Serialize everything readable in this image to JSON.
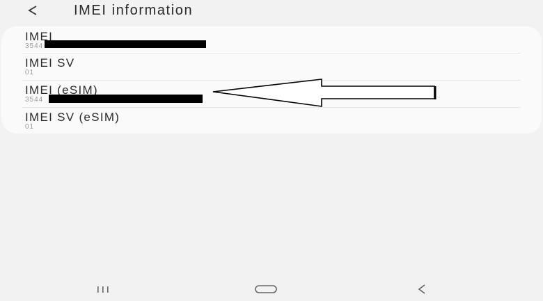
{
  "header": {
    "title": "IMEI information",
    "back_icon": "chevron-left-icon"
  },
  "list": {
    "items": [
      {
        "title": "IMEI",
        "value": "3544",
        "value_redacted": true
      },
      {
        "title": "IMEI SV",
        "value": "01",
        "value_redacted": false
      },
      {
        "title": "IMEI (eSIM)",
        "value": "3544",
        "value_redacted": true
      },
      {
        "title": "IMEI SV (eSIM)",
        "value": "01",
        "value_redacted": false
      }
    ]
  },
  "annotation": {
    "icon": "arrow-left-outline",
    "points_to": "IMEI (eSIM)"
  },
  "nav": {
    "recents_icon": "recents-icon",
    "home_icon": "home-icon",
    "back_icon": "back-icon"
  },
  "colors": {
    "background": "#f2f2f2",
    "card": "#fafafa",
    "primary_text": "#2a2a2a",
    "secondary_text": "#9a9a9a",
    "redaction": "#000000"
  }
}
